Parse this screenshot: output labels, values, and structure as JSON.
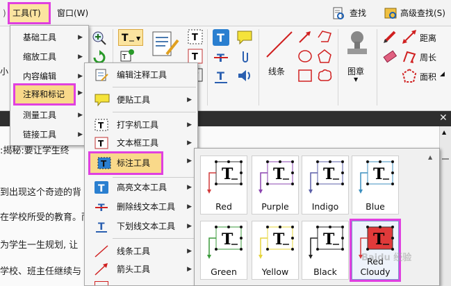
{
  "menubar": {
    "tools": "工具(T)",
    "window": "窗口(W)",
    "search": "查找(F)",
    "advanced_search": "高级查找(S)"
  },
  "ribbon": {
    "line_label": "线条",
    "stamp_label": "图章",
    "distance_label": "距离",
    "perimeter_label": "周长",
    "area_label": "面积",
    "cut_text": "小"
  },
  "tools_menu": {
    "items": [
      {
        "label": "基础工具"
      },
      {
        "label": "缩放工具"
      },
      {
        "label": "内容编辑"
      },
      {
        "label": "注释和标记"
      },
      {
        "label": "测量工具"
      },
      {
        "label": "链接工具"
      }
    ]
  },
  "annot_menu": {
    "items": [
      {
        "label": "编辑注释工具"
      },
      {
        "label": "便贴工具"
      },
      {
        "label": "打字机工具"
      },
      {
        "label": "文本框工具"
      },
      {
        "label": "标注工具"
      },
      {
        "label": "高亮文本工具"
      },
      {
        "label": "删除线文本工具"
      },
      {
        "label": "下划线文本工具"
      },
      {
        "label": "线条工具"
      },
      {
        "label": "箭头工具"
      }
    ]
  },
  "palette": {
    "tiles": [
      {
        "label": "Red",
        "color": "#d23a3a"
      },
      {
        "label": "Purple",
        "color": "#8b44b0"
      },
      {
        "label": "Indigo",
        "color": "#5b5fa8"
      },
      {
        "label": "Blue",
        "color": "#3c8fbf"
      },
      {
        "label": "Green",
        "color": "#3a9a3a"
      },
      {
        "label": "Yellow",
        "color": "#e5d43a"
      },
      {
        "label": "Black",
        "color": "#222222"
      },
      {
        "label": "Red Cloudy",
        "color": "#d23a3a"
      }
    ]
  },
  "document": {
    "lines": [
      ":揭秘:要让学生终",
      "到出现这个奇迹的背",
      "在学校所受的教育。而",
      "为学生一生规划, 让",
      "学校、班主任继续与"
    ]
  },
  "watermark": "Baidu 经验"
}
